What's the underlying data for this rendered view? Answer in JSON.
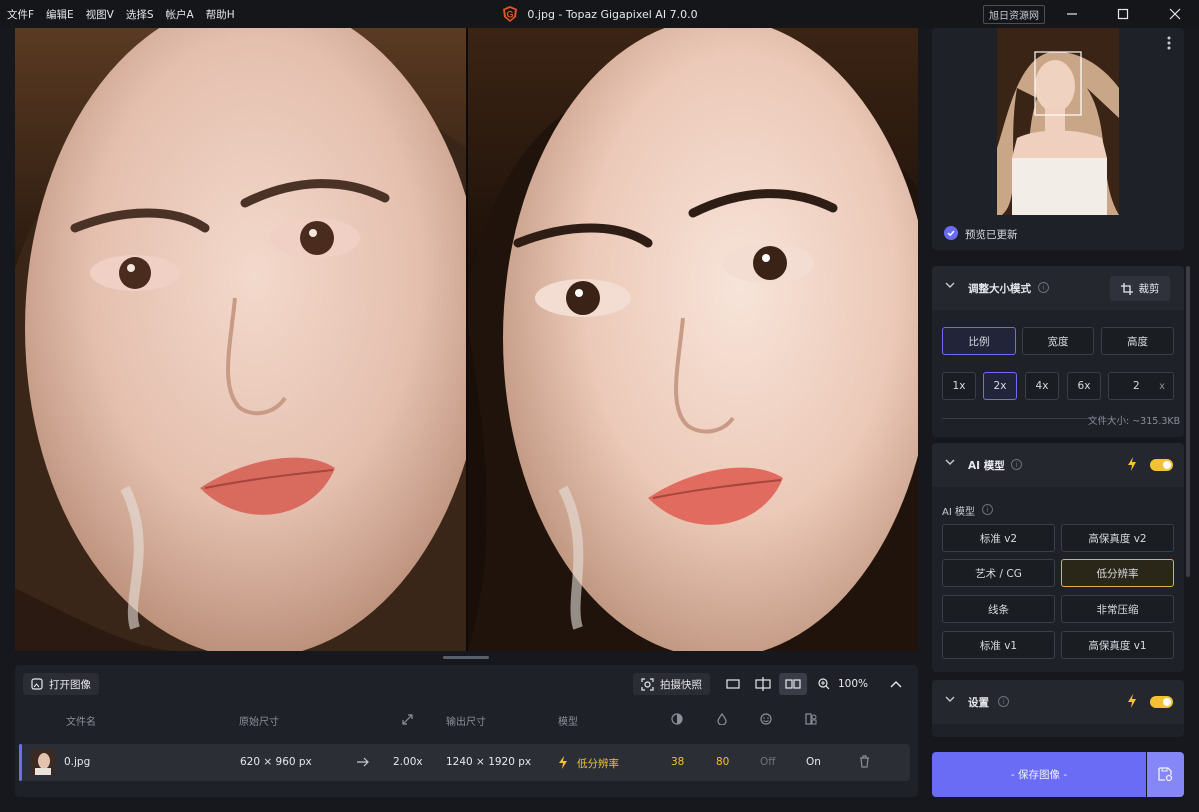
{
  "menu": [
    "文件F",
    "编辑E",
    "视图V",
    "选择S",
    "帐户A",
    "帮助H"
  ],
  "window": {
    "title": "0.jpg - Topaz Gigapixel AI 7.0.0",
    "res_button": "旭日资源网"
  },
  "preview": {
    "status": "预览已更新"
  },
  "resize": {
    "title": "调整大小模式",
    "crop": "裁剪",
    "modes": [
      "比例",
      "宽度",
      "高度"
    ],
    "scales": [
      "1x",
      "2x",
      "4x",
      "6x"
    ],
    "custom_value": "2",
    "custom_unit": "x",
    "file_size": "文件大小: ~315.3KB"
  },
  "ai": {
    "title": "AI 模型",
    "sub_label": "AI 模型",
    "models": [
      "标准 v2",
      "高保真度 v2",
      "艺术 / CG",
      "低分辨率",
      "线条",
      "非常压缩",
      "标准 v1",
      "高保真度 v1"
    ],
    "selected": "低分辨率"
  },
  "settings": {
    "title": "设置"
  },
  "save": {
    "label": "- 保存图像 -"
  },
  "toolbar": {
    "open": "打开图像",
    "snapshot": "拍摄快照",
    "zoom": "100%"
  },
  "table": {
    "headers": {
      "file": "文件名",
      "orig": "原始尺寸",
      "out": "输出尺寸",
      "model": "模型"
    },
    "row": {
      "file": "0.jpg",
      "orig": "620 × 960 px",
      "scale": "2.00x",
      "out": "1240 × 1920 px",
      "model": "低分辨率",
      "v1": "38",
      "v2": "80",
      "v3": "Off",
      "v4": "On"
    }
  },
  "colors": {
    "accent": "#6a6cf6",
    "gold": "#f2c233",
    "panel": "#1e2127"
  }
}
